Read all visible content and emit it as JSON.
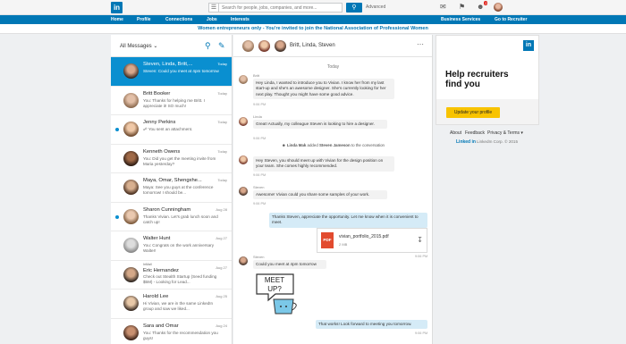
{
  "topbar": {
    "logo": "in",
    "search_placeholder": "Search for people, jobs, companies, and more...",
    "advanced": "Advanced",
    "notifications_badge": "2"
  },
  "nav": [
    "Home",
    "Profile",
    "Connections",
    "Jobs",
    "Interests"
  ],
  "nav_right": [
    "Business Services",
    "Go to Recruiter"
  ],
  "banner": "Women entrepreneurs only - You're invited to join the National Association of Professional Women",
  "inbox": {
    "title": "All Messages",
    "threads": [
      {
        "name": "Steven, Linda, Britt,...",
        "date": "Today",
        "snippet": "Steven: Could you meet at 4pm tomorrow"
      },
      {
        "name": "Britt Booker",
        "date": "Today",
        "snippet": "You: Thanks for helping me Britt. I appreciate it! SO much!"
      },
      {
        "name": "Jenny Perkins",
        "date": "Today",
        "snippet": "You sent an attachment."
      },
      {
        "name": "Kenneth Owens",
        "date": "Today",
        "snippet": "You: Did you get the meeting invite from Maria yesterday?"
      },
      {
        "name": "Maya, Omar, Shengxhe...",
        "date": "Today",
        "snippet": "Maya: See you guys at the conference tomorrow! I should be..."
      },
      {
        "name": "Sharon Cunningham",
        "date": "Aug 28",
        "snippet": "Thanks Vivian. Let's grab lunch soon and catch up!"
      },
      {
        "name": "Walter Hunt",
        "date": "Aug 27",
        "snippet": "You: Congrats on the work anniversary Walter!"
      },
      {
        "name": "Eric Hernandez",
        "tag": "InMail",
        "date": "Aug 27",
        "snippet": "Check out Stealth Startup (Seed funding $5M) - Looking for Lead..."
      },
      {
        "name": "Harold Lee",
        "date": "Aug 25",
        "snippet": "Hi Vivian, we are in the same LinkedIn group and saw we liked..."
      },
      {
        "name": "Sara and Omar",
        "date": "Aug 24",
        "snippet": "You: Thanks for the recommendation you guys!"
      }
    ]
  },
  "conversation": {
    "title": "Britt, Linda, Steven",
    "day": "Today",
    "messages": [
      {
        "sender": "Britt",
        "text": "Hey Linda, I wanted to introduce you to Vivian. I know her from my last start-up and she's an awesome designer. She's currently looking for her next play. Thought you might have some good advice.",
        "time": "9:06 PM"
      },
      {
        "sender": "Linda",
        "text": "Great! Actually, my colleague Steven is looking to hire a designer.",
        "time": "9:06 PM"
      },
      {
        "system_name": "Linda Mak",
        "system_text": "added",
        "system_target": "Steven Jameson",
        "system_tail": "to the conversation"
      },
      {
        "sender": "",
        "text": "Hey Steven, you should meet up with Vivian for the design position on your team. She comes highly recommended.",
        "time": "9:06 PM"
      },
      {
        "sender": "Steven",
        "text": "Awesome! Vivian could you share some samples of your work.",
        "time": "9:06 PM"
      },
      {
        "own": true,
        "text": "Thanks Steven, appreciate the opportunity. Let me know when it is convenient to meet."
      },
      {
        "sender": "Steven",
        "text": "Could you meet at 4pm tomorrow",
        "time": "9:06 PM"
      },
      {
        "own": true,
        "text": "That works! Look forward to meeting you tomorrow.",
        "time": "9:06 PM"
      }
    ],
    "attachment": {
      "name": "vivian_portfolio_2015.pdf",
      "size": "2 MB",
      "label": "PDF",
      "time": "9:06 PM"
    },
    "sticker": {
      "line1": "MEET",
      "line2": "UP?"
    }
  },
  "ad": {
    "headline": "Help recruiters find you",
    "cta": "Update your profile"
  },
  "footer": {
    "links": [
      "About",
      "Feedback",
      "Privacy & Terms ▾"
    ],
    "brand": "Linked in",
    "copyright": "LinkedIn Corp. © 2015"
  }
}
